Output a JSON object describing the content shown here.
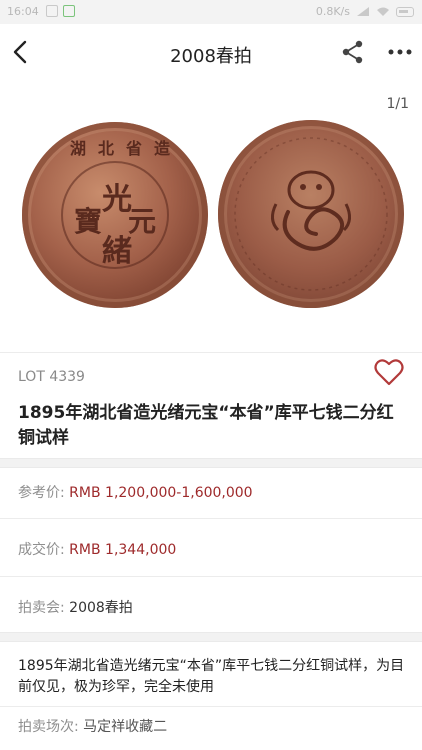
{
  "status_bar": {
    "time": "16:04",
    "network": "0.8K/s",
    "battery": "25"
  },
  "nav": {
    "title": "2008春拍"
  },
  "gallery": {
    "counter": "1/1"
  },
  "coin_inscriptions": {
    "obverse_center": [
      "光",
      "緒",
      "元",
      "寶"
    ],
    "obverse_top": "湖北省造"
  },
  "lot": {
    "number": "LOT 4339",
    "title": "1895年湖北省造光绪元宝“本省”库平七钱二分红铜试样"
  },
  "fields": {
    "estimate_label": "参考价:",
    "estimate_value": "RMB 1,200,000-1,600,000",
    "sold_label": "成交价:",
    "sold_value": "RMB 1,344,000",
    "auction_label": "拍卖会:",
    "auction_value": "2008春拍"
  },
  "description": "1895年湖北省造光绪元宝“本省”库平七钱二分红铜试样，为目前仅见，极为珍罕，完全未使用",
  "session": {
    "label": "拍卖场次:",
    "value": "马定祥收藏二"
  },
  "colors": {
    "accent": "#9e2a2b",
    "heart": "#b23a3a"
  }
}
